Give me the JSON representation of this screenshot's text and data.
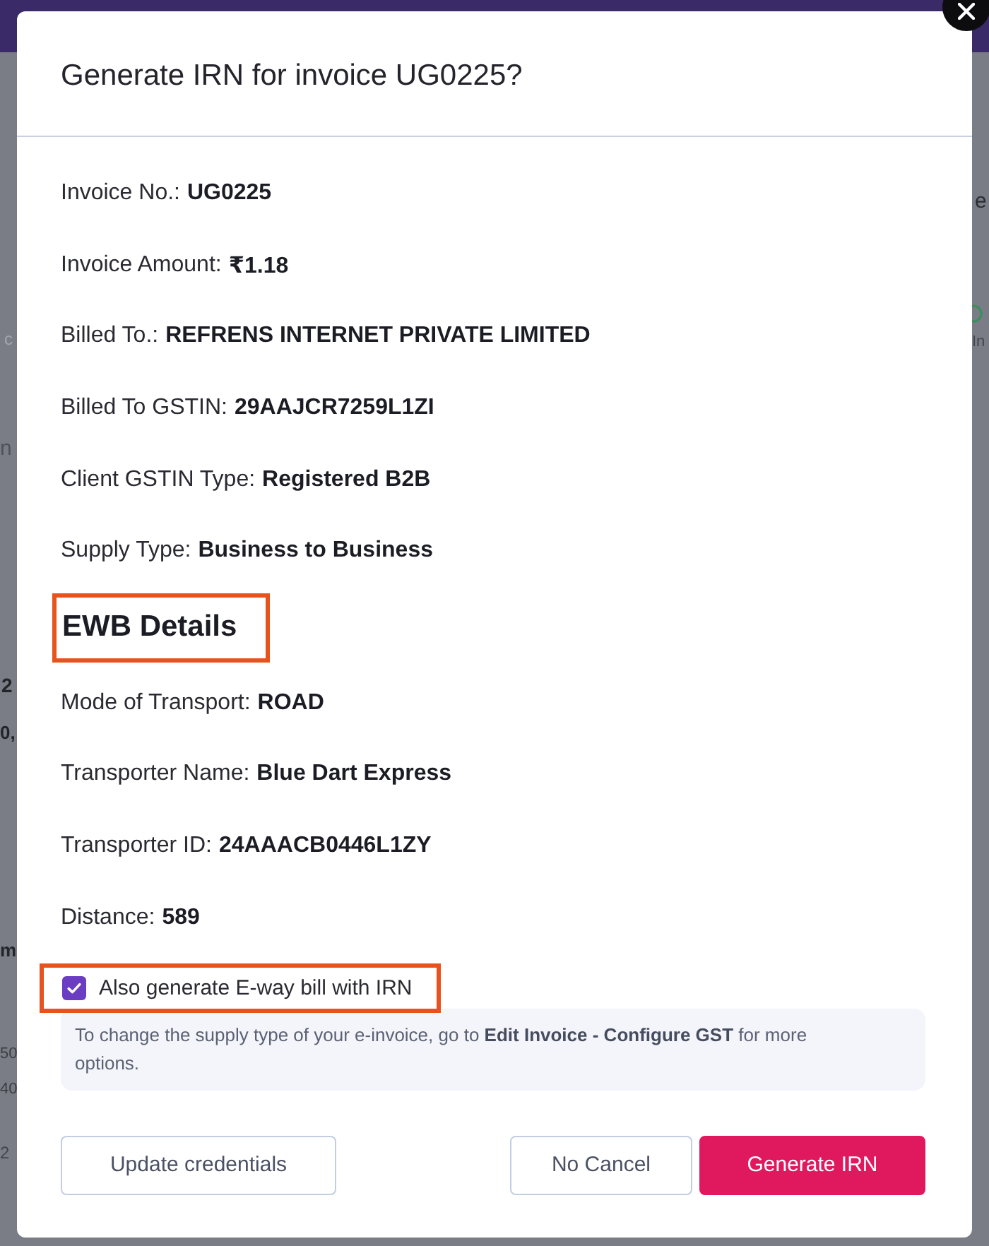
{
  "background": {
    "left_fragments": [
      "c",
      "n",
      "2",
      "0,",
      "m",
      "50",
      "40",
      "2"
    ],
    "right_fragments": [
      "e",
      "In"
    ]
  },
  "dialog": {
    "title": "Generate IRN for invoice UG0225?",
    "details": [
      {
        "label": "Invoice No.:",
        "value": "UG0225"
      },
      {
        "label": "Invoice Amount:",
        "value": "₹1.18"
      },
      {
        "label": "Billed To.:",
        "value": "REFRENS INTERNET PRIVATE LIMITED"
      },
      {
        "label": "Billed To GSTIN:",
        "value": "29AAJCR7259L1ZI"
      },
      {
        "label": "Client GSTIN Type:",
        "value": "Registered B2B"
      },
      {
        "label": "Supply Type:",
        "value": "Business to Business"
      }
    ],
    "ewb_section": {
      "heading": "EWB Details",
      "highlighted": true,
      "details": [
        {
          "label": "Mode of Transport:",
          "value": "ROAD"
        },
        {
          "label": "Transporter Name:",
          "value": "Blue Dart Express"
        },
        {
          "label": "Transporter ID:",
          "value": "24AAACB0446L1ZY"
        },
        {
          "label": "Distance:",
          "value": "589"
        }
      ]
    },
    "eway_option": {
      "label": "Also generate E-way bill with IRN",
      "checked": true,
      "highlighted": true
    },
    "note": "To change the supply type of your e-invoice, go to **Edit Invoice - Configure GST** for more options.",
    "left_buttons": [
      {
        "label": "Update credentials",
        "kind": "secondary"
      }
    ],
    "right_buttons": [
      {
        "label": "No Cancel",
        "kind": "secondary"
      },
      {
        "label": "Generate IRN",
        "kind": "primary"
      }
    ]
  }
}
